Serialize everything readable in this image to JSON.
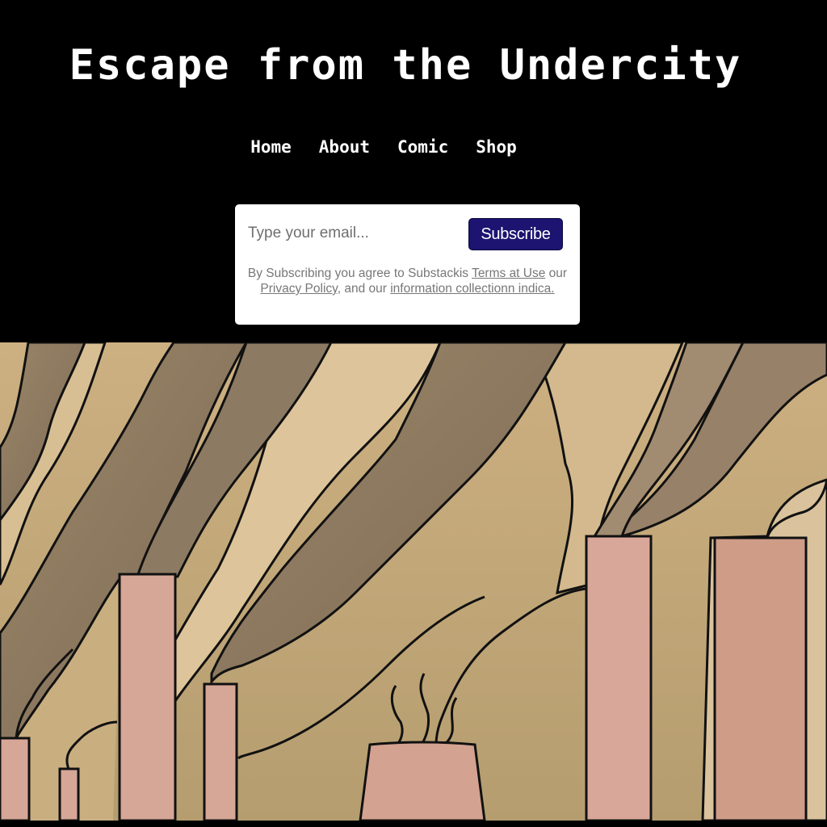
{
  "site": {
    "title": "Escape from the Undercity"
  },
  "nav": {
    "items": [
      {
        "label": "Home"
      },
      {
        "label": "About"
      },
      {
        "label": "Comic"
      },
      {
        "label": "Shop"
      }
    ]
  },
  "subscribe": {
    "placeholder": "Type your email...",
    "button_label": "Subscribe",
    "legal": {
      "prefix": "By Subscribing you agree  to Substackis ",
      "terms": "Terms at Use",
      "middle1": " our ",
      "privacy": "Privacy Policy,",
      "middle2": " and our ",
      "collection": "information collectionn indica."
    }
  },
  "colors": {
    "background": "#000000",
    "button": "#1c1470",
    "chimney": "#d6a697",
    "sky_light": "#dcc39a",
    "sky_mid": "#c4a775",
    "smoke_dark": "#8a7763"
  },
  "hero": {
    "icon": "factory-smokestacks-illustration"
  }
}
